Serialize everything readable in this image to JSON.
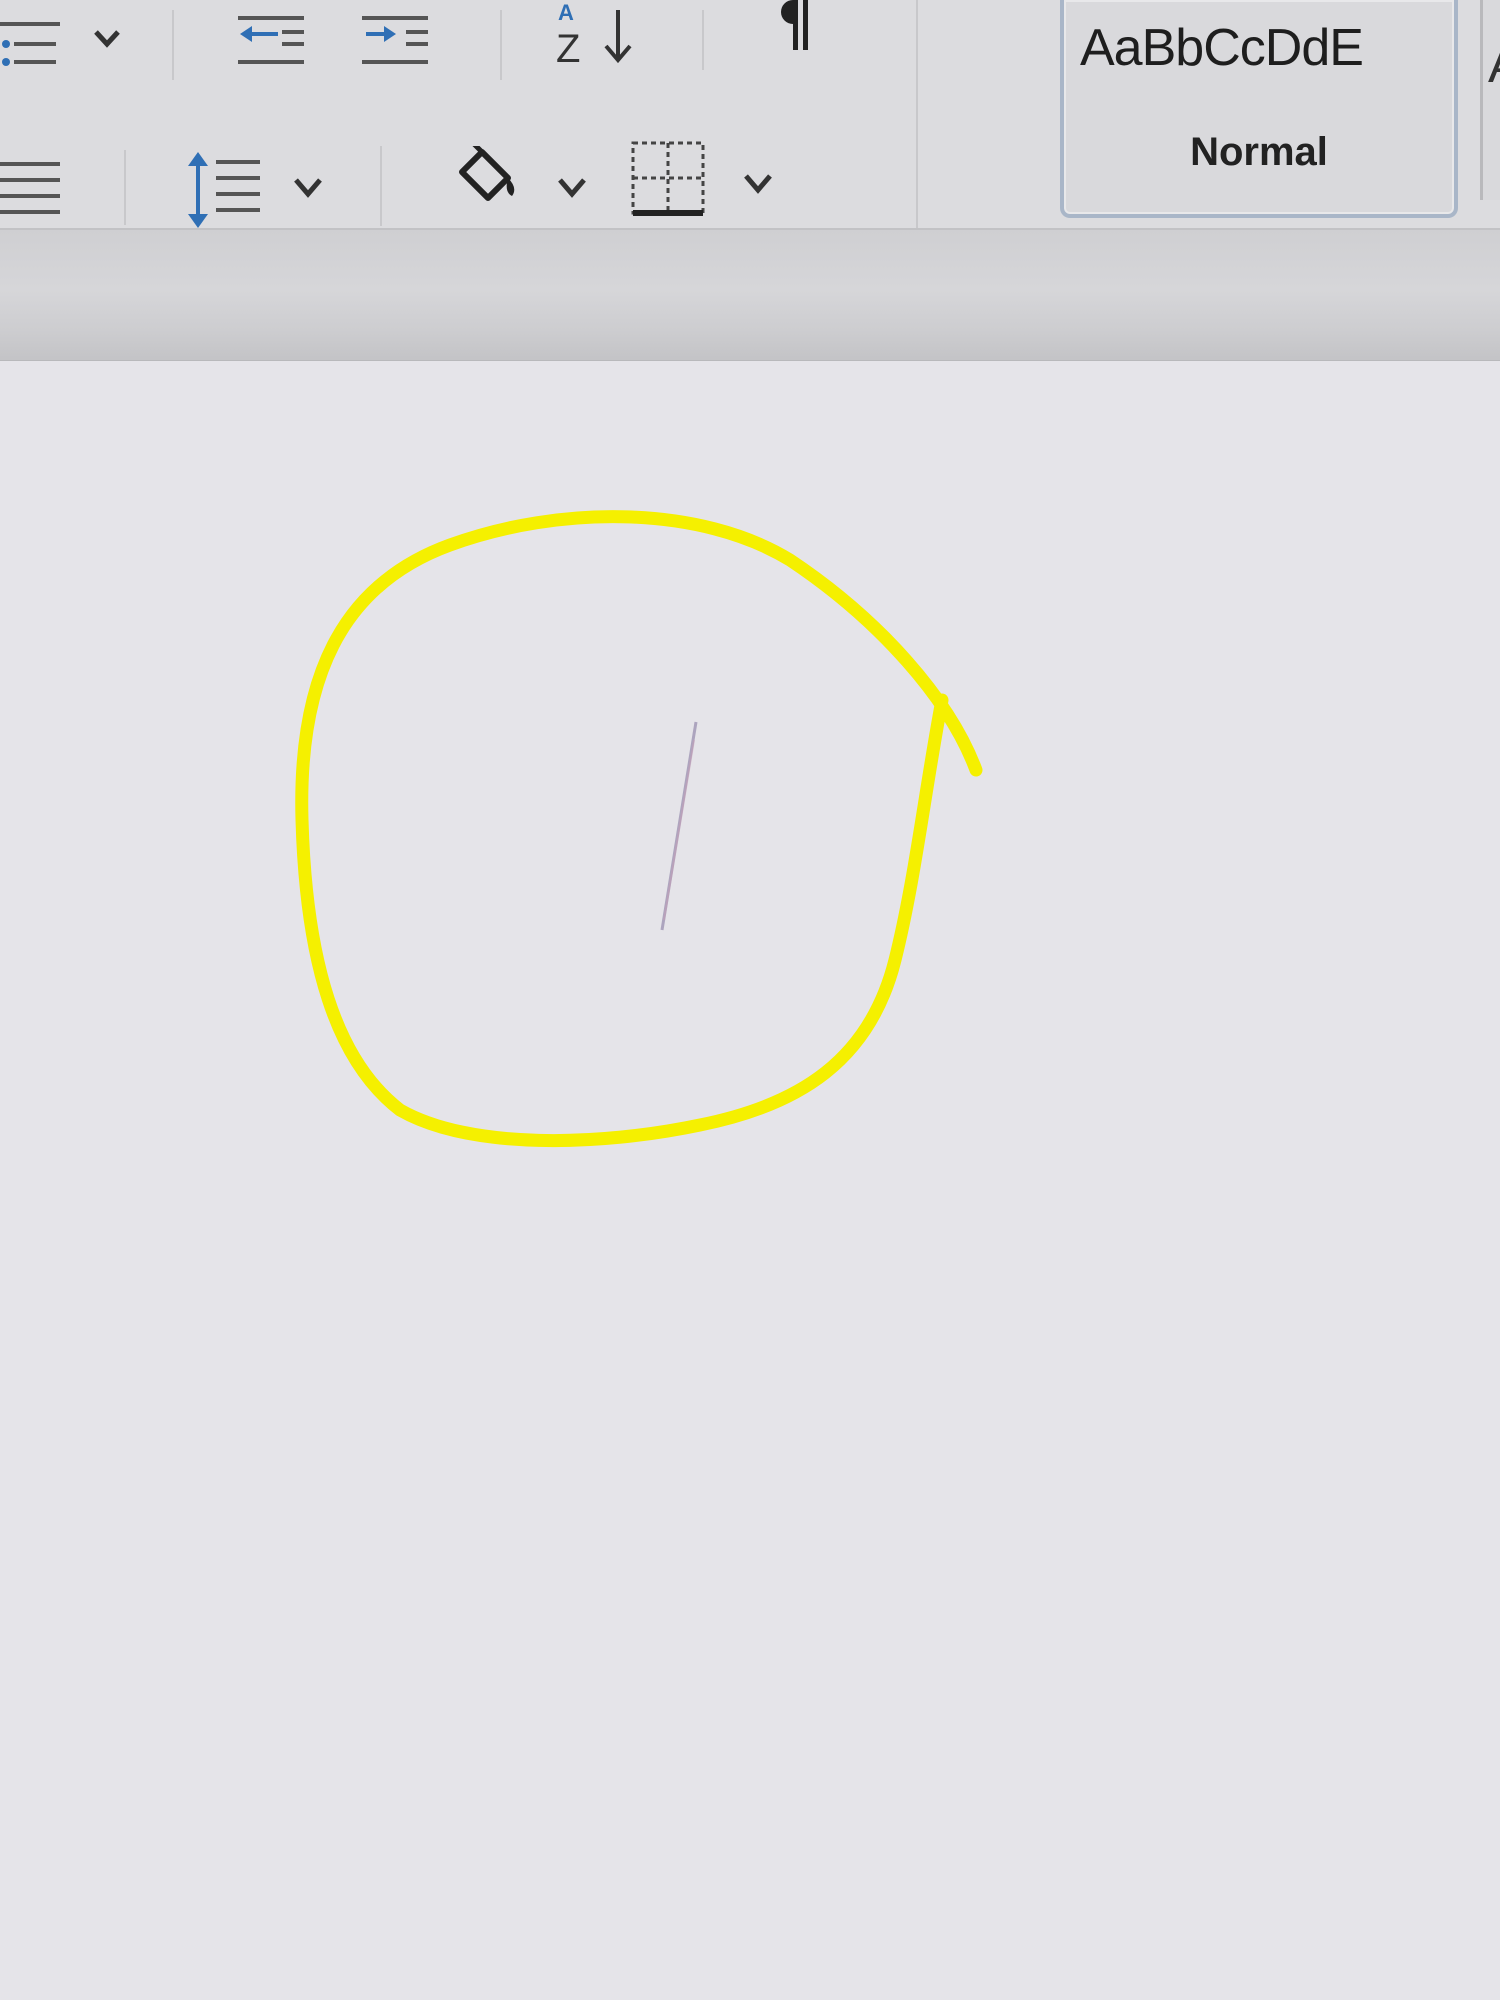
{
  "ribbon": {
    "style_gallery": {
      "preview_text": "AaBbCcDdE",
      "style_name": "Normal",
      "next_style_preview": "A"
    },
    "icons": {
      "bullets": "bullet-list-icon",
      "decrease_indent": "decrease-indent-icon",
      "increase_indent": "increase-indent-icon",
      "sort": "sort-az-icon",
      "show_marks": "pilcrow-icon",
      "align": "justify-align-icon",
      "line_spacing": "line-spacing-icon",
      "shading": "paint-bucket-icon",
      "borders": "borders-icon"
    }
  },
  "annotation": {
    "color": "#f5f000",
    "shape": "hand-drawn circle around text cursor"
  },
  "colors": {
    "ribbon_bg": "#dcdcdf",
    "document_bg": "#e5e4e9",
    "style_box_border": "#a9b6c8",
    "icon_blue": "#2f6fb5"
  }
}
